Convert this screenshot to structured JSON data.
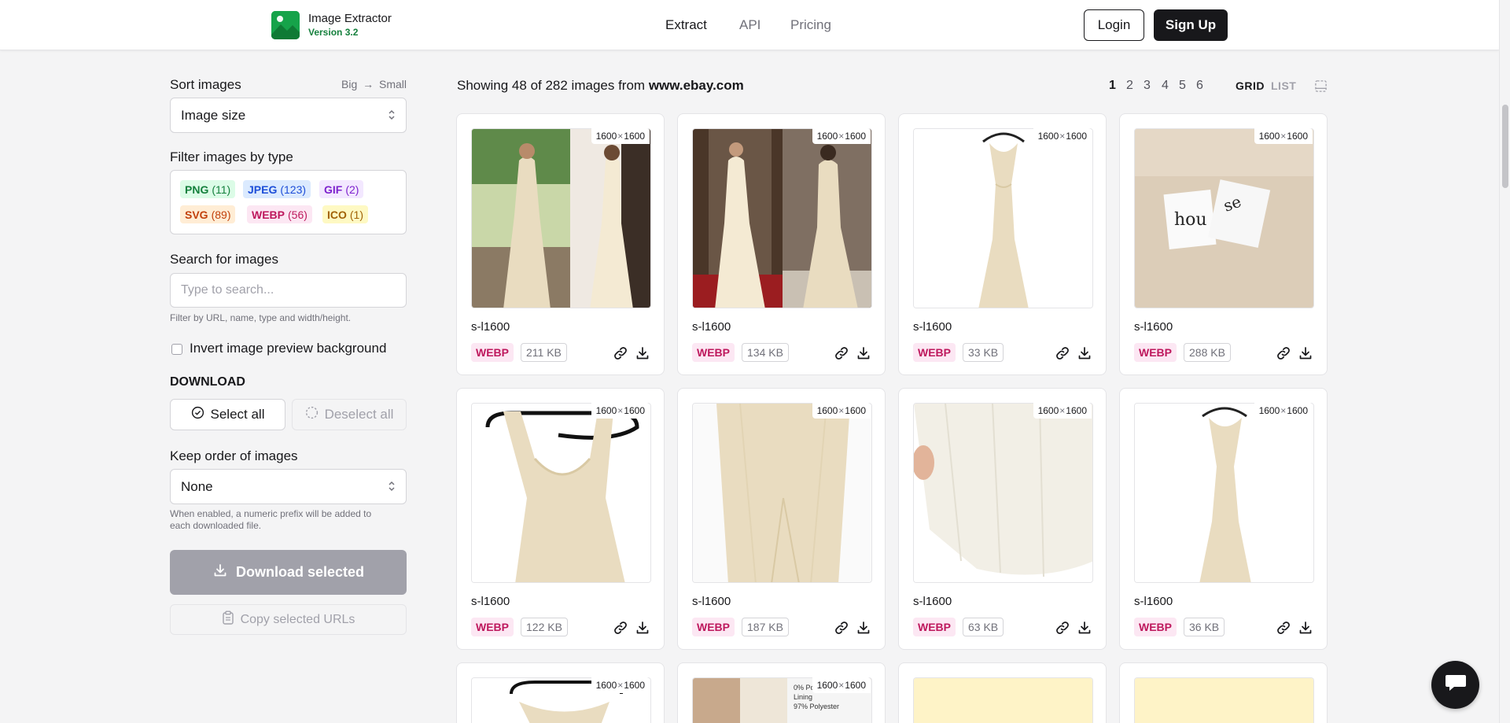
{
  "header": {
    "brand_name": "Image Extractor",
    "brand_version": "Version 3.2",
    "nav": [
      {
        "label": "Extract",
        "active": true
      },
      {
        "label": "API",
        "active": false
      },
      {
        "label": "Pricing",
        "active": false
      }
    ],
    "login_label": "Login",
    "signup_label": "Sign Up"
  },
  "sidebar": {
    "sort_label": "Sort images",
    "sort_hint_left": "Big",
    "sort_hint_right": "Small",
    "sort_value": "Image size",
    "filter_label": "Filter images by type",
    "type_tags": [
      {
        "name": "PNG",
        "count": "(11)",
        "bg": "#dcfce7",
        "fg": "#15803d"
      },
      {
        "name": "JPEG",
        "count": "(123)",
        "bg": "#dbeafe",
        "fg": "#1d4ed8"
      },
      {
        "name": "GIF",
        "count": "(2)",
        "bg": "#f3e8ff",
        "fg": "#7e22ce"
      },
      {
        "name": "SVG",
        "count": "(89)",
        "bg": "#ffedd5",
        "fg": "#c2410c"
      },
      {
        "name": "WEBP",
        "count": "(56)",
        "bg": "#fce7f3",
        "fg": "#be185d"
      },
      {
        "name": "ICO",
        "count": "(1)",
        "bg": "#fef9c3",
        "fg": "#a16207"
      }
    ],
    "search_label": "Search for images",
    "search_placeholder": "Type to search...",
    "search_value": "",
    "search_hint": "Filter by URL, name, type and width/height.",
    "invert_label": "Invert image preview background",
    "invert_checked": false,
    "download_heading": "DOWNLOAD",
    "select_all_label": "Select all",
    "deselect_all_label": "Deselect all",
    "keep_order_label": "Keep order of images",
    "keep_order_value": "None",
    "keep_order_hint_1": "When enabled, a numeric prefix will be added to",
    "keep_order_hint_2": "each downloaded file.",
    "download_selected_label": "Download selected",
    "copy_urls_label": "Copy selected URLs"
  },
  "main": {
    "showing_prefix": "Showing 48 of 282 images from",
    "showing_domain": "www.ebay.com",
    "pages": [
      "1",
      "2",
      "3",
      "4",
      "5",
      "6"
    ],
    "current_page": "1",
    "view_grid": "GRID",
    "view_list": "LIST",
    "view_active": "GRID",
    "cards": [
      {
        "dims_w": "1600",
        "dims_h": "1600",
        "name": "s-l1600",
        "type": "WEBP",
        "size": "211 KB"
      },
      {
        "dims_w": "1600",
        "dims_h": "1600",
        "name": "s-l1600",
        "type": "WEBP",
        "size": "134 KB"
      },
      {
        "dims_w": "1600",
        "dims_h": "1600",
        "name": "s-l1600",
        "type": "WEBP",
        "size": "33 KB"
      },
      {
        "dims_w": "1600",
        "dims_h": "1600",
        "name": "s-l1600",
        "type": "WEBP",
        "size": "288 KB"
      },
      {
        "dims_w": "1600",
        "dims_h": "1600",
        "name": "s-l1600",
        "type": "WEBP",
        "size": "122 KB"
      },
      {
        "dims_w": "1600",
        "dims_h": "1600",
        "name": "s-l1600",
        "type": "WEBP",
        "size": "187 KB"
      },
      {
        "dims_w": "1600",
        "dims_h": "1600",
        "name": "s-l1600",
        "type": "WEBP",
        "size": "63 KB"
      },
      {
        "dims_w": "1600",
        "dims_h": "1600",
        "name": "s-l1600",
        "type": "WEBP",
        "size": "36 KB"
      }
    ],
    "partial_cards": [
      {
        "dims_w": "1600",
        "dims_h": "1600",
        "photo_text": ""
      },
      {
        "dims_w": "1600",
        "dims_h": "1600",
        "photo_text": "0% Polyester\nLining\n97% Polyester"
      },
      {
        "dims_w": "",
        "dims_h": "",
        "photo_text": ""
      },
      {
        "dims_w": "",
        "dims_h": "",
        "photo_text": ""
      }
    ]
  },
  "colors": {
    "brand_green": "#16a34a",
    "primary_dark": "#18181b",
    "webp_badge_bg": "#fce7f3",
    "webp_badge_fg": "#be185d",
    "disabled_button": "#a1a1aa"
  },
  "icons": [
    "image-logo-icon",
    "chevron-updown-icon",
    "arrow-right-icon",
    "check-circle-icon",
    "dashed-circle-icon",
    "download-icon",
    "clipboard-icon",
    "link-icon",
    "layout-icon",
    "chat-icon"
  ]
}
